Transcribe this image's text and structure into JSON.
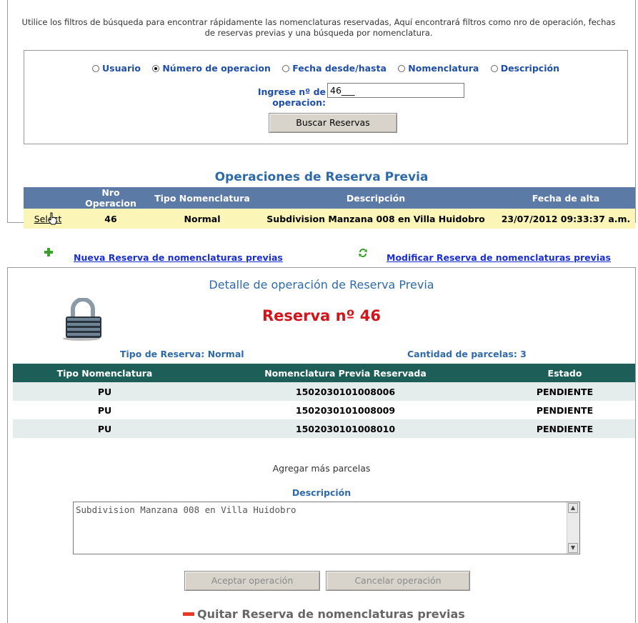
{
  "intro": {
    "line1": "Utilice los filtros de búsqueda para encontrar rápidamente las nomenclaturas reservadas, Aquí encontrará filtros como nro de operación, fechas",
    "line2": "de reservas previas y una búsqueda  por nomenclatura."
  },
  "filters": {
    "options": [
      {
        "label": "Usuario",
        "selected": false
      },
      {
        "label": "Número de operacion",
        "selected": true
      },
      {
        "label": "Fecha desde/hasta",
        "selected": false
      },
      {
        "label": "Nomenclatura",
        "selected": false
      },
      {
        "label": "Descripción",
        "selected": false
      }
    ],
    "op_label": "Ingrese nº de operacion:",
    "op_value": "46___",
    "search_button": "Buscar Reservas"
  },
  "operations": {
    "title": "Operaciones de Reserva Previa",
    "headers": [
      "",
      "Nro Operacion",
      "Tipo Nomenclatura",
      "Descripción",
      "Fecha de alta"
    ],
    "rows": [
      {
        "select": "Select",
        "nro": "46",
        "tipo": "Normal",
        "descripcion": "Subdivision Manzana 008 en Villa Huidobro",
        "fecha": "23/07/2012 09:33:37 a.m."
      }
    ]
  },
  "links": {
    "nueva": "Nueva Reserva de nomenclaturas previas",
    "modificar": "Modificar Reserva de nomenclaturas previas"
  },
  "detail": {
    "title": "Detalle de operación de Reserva Previa",
    "reserva": "Reserva nº 46",
    "tipo_reserva": "Tipo de Reserva:  Normal",
    "cantidad": "Cantidad de parcelas: 3",
    "headers": [
      "Tipo Nomenclatura",
      "Nomenclatura Previa Reservada",
      "Estado"
    ],
    "rows": [
      {
        "tipo": "PU",
        "nomenclatura": "1502030101008006",
        "estado": "PENDIENTE"
      },
      {
        "tipo": "PU",
        "nomenclatura": "1502030101008009",
        "estado": "PENDIENTE"
      },
      {
        "tipo": "PU",
        "nomenclatura": "1502030101008010",
        "estado": "PENDIENTE"
      }
    ],
    "agregar": "Agregar más parcelas",
    "desc_label": "Descripción",
    "desc_value": "Subdivision Manzana 008 en Villa Huidobro",
    "aceptar": "Aceptar operación",
    "cancelar": "Cancelar operación",
    "quitar": "Quitar Reserva de nomenclaturas previas"
  },
  "icons": {
    "plus": "plus-icon",
    "refresh": "refresh-icon",
    "lock": "lock-icon",
    "minus": "minus-icon",
    "hand_cursor": "hand-cursor-icon"
  },
  "colors": {
    "accent_blue": "#2f6aa8",
    "table_header_blue": "#5b7aa6",
    "selected_row_yellow": "#fbf6b7",
    "detail_header_green": "#1d5e59",
    "reserva_red": "#d4141b",
    "link_blue": "#1a2fd0"
  }
}
